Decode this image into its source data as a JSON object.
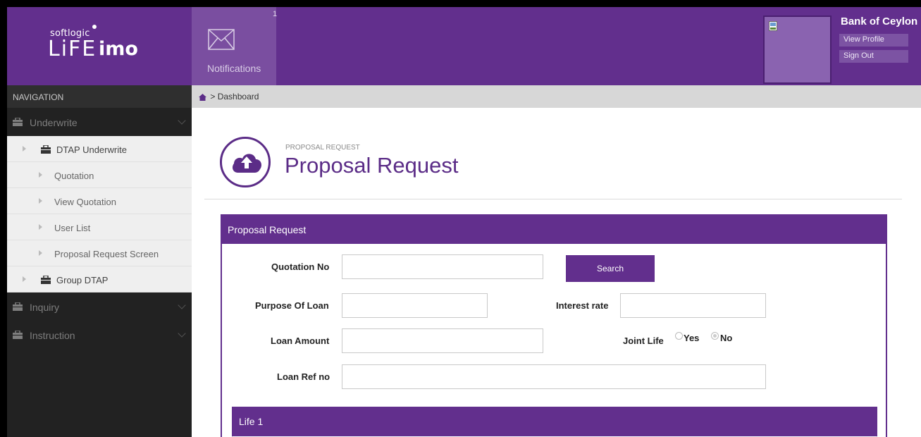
{
  "header": {
    "logo_small": "softlogic",
    "logo_life": "LiFE",
    "logo_imo": "imo",
    "notifications_count": "1",
    "notifications_label": "Notifications",
    "bank_name": "Bank of Ceylon",
    "view_profile": "View Profile",
    "sign_out": "Sign Out"
  },
  "sidebar": {
    "title": "NAVIGATION",
    "groups": [
      {
        "label": "Underwrite",
        "icon": "briefcase-icon"
      },
      {
        "label": "Inquiry",
        "icon": "briefcase-icon"
      },
      {
        "label": "Instruction",
        "icon": "briefcase-icon"
      }
    ],
    "items": [
      {
        "label": "DTAP Underwrite"
      },
      {
        "label": "Quotation"
      },
      {
        "label": "View Quotation"
      },
      {
        "label": "User List"
      },
      {
        "label": "Proposal Request Screen"
      },
      {
        "label": "Group DTAP"
      }
    ]
  },
  "breadcrumb": {
    "current": "Dashboard",
    "separator": ">"
  },
  "page": {
    "subtitle": "PROPOSAL REQUEST",
    "title": "Proposal Request"
  },
  "form": {
    "panel_title": "Proposal Request",
    "quotation_no_label": "Quotation No",
    "quotation_no_value": "",
    "search_label": "Search",
    "purpose_label": "Purpose Of Loan",
    "purpose_value": "",
    "interest_label": "Interest rate",
    "interest_value": "",
    "loan_amount_label": "Loan Amount",
    "loan_amount_value": "",
    "joint_life_label": "Joint Life",
    "joint_yes": "Yes",
    "joint_no": "No",
    "joint_selected": "No",
    "loan_ref_label": "Loan Ref no",
    "loan_ref_value": "",
    "life_section": "Life 1"
  },
  "colors": {
    "brand_purple": "#622f8d",
    "sidebar_dark": "#222222",
    "breadcrumb_bg": "#d7d7d7"
  }
}
